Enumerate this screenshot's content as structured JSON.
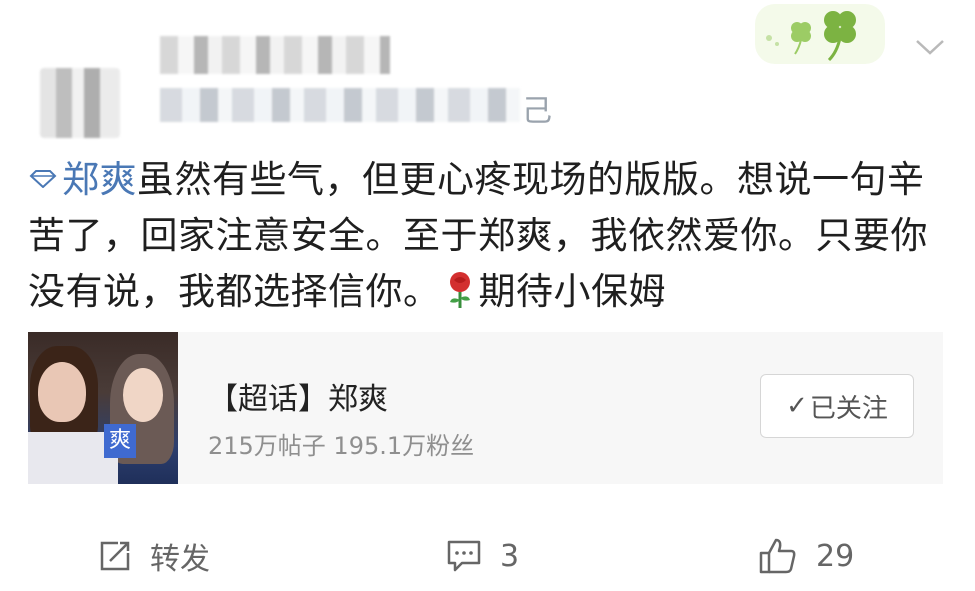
{
  "header": {
    "meta_tail": "己",
    "menu_icon": "chevron-down-icon",
    "decoration_icon": "clover-icon"
  },
  "post": {
    "topic_icon": "diamond-topic-icon",
    "topic": "郑爽",
    "text_1": "虽然有些气，但更心疼现场的版版。想说一句辛苦了，回家注意安全。至于郑爽，我依然爱你。只要你没有说，我都选择信你。",
    "emoji": "rose-icon",
    "text_2": "期待小保姆"
  },
  "card": {
    "badge": "爽",
    "title": "【超话】郑爽",
    "subtitle": "215万帖子 195.1万粉丝",
    "follow_check": "✓",
    "follow_label": "已关注"
  },
  "actions": {
    "repost_label": "转发",
    "comment_count": "3",
    "like_count": "29"
  },
  "colors": {
    "link": "#4a78b5",
    "card_bg": "#f7f7f7",
    "muted": "#8f8f8f",
    "clover": "#8bc34a"
  }
}
